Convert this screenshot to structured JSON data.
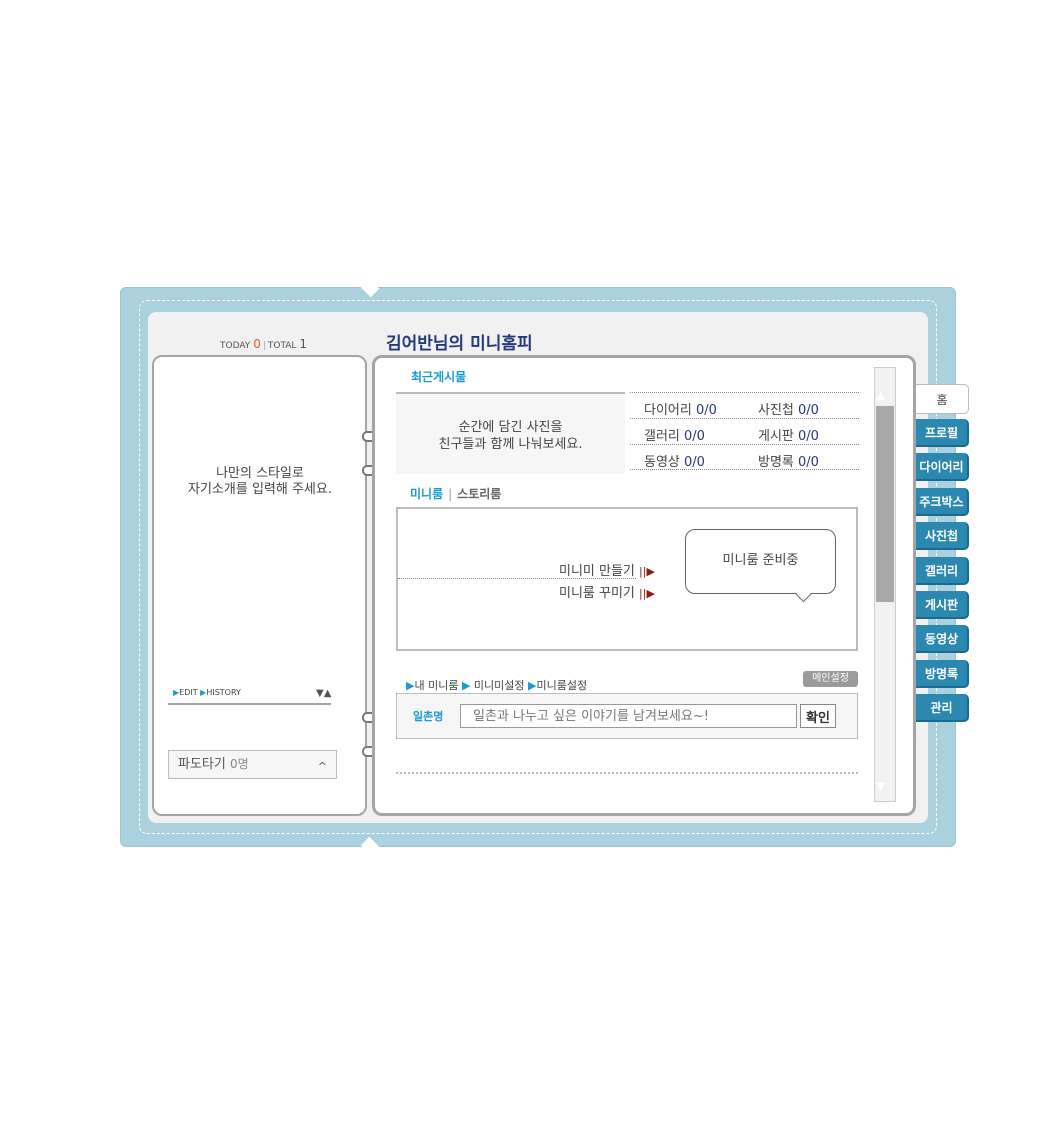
{
  "counter": {
    "today_label": "TODAY",
    "today_value": "0",
    "sep": "|",
    "total_label": "TOTAL",
    "total_value": "1"
  },
  "header": {
    "title": "김어반님의 미니홈피"
  },
  "profile": {
    "intro_line1": "나만의 스타일로",
    "intro_line2": "자기소개를 입력해 주세요.",
    "edit_label": "EDIT",
    "history_label": "HISTORY",
    "sort_arrows": "▼▲"
  },
  "pado": {
    "label": "파도타기",
    "count": "0명",
    "caret": "^"
  },
  "recent": {
    "title": "최근게시물",
    "photo_line1": "순간에 담긴 사진을",
    "photo_line2": "친구들과 함께 나눠보세요.",
    "stats": [
      {
        "name": "다이어리",
        "value": "0/0"
      },
      {
        "name": "사진첩",
        "value": "0/0"
      },
      {
        "name": "갤러리",
        "value": "0/0"
      },
      {
        "name": "게시판",
        "value": "0/0"
      },
      {
        "name": "동영상",
        "value": "0/0"
      },
      {
        "name": "방명록",
        "value": "0/0"
      }
    ]
  },
  "room_tabs": {
    "tab1": "미니룸",
    "separator": "|",
    "tab2": "스토리룸"
  },
  "miniroom": {
    "link1": "미니미 만들기",
    "link2": "미니룸 꾸미기",
    "bubble": "미니룸 준비중",
    "arrow_glyph": "||▶",
    "links": [
      {
        "label": "내 미니룸"
      },
      {
        "label": "미니미설정"
      },
      {
        "label": "미니룸설정"
      }
    ],
    "main_setting": "메인설정"
  },
  "guestbook": {
    "label": "일촌명",
    "placeholder": "일촌과 나누고 싶은 이야기를 남겨보세요~!",
    "confirm": "확인"
  },
  "scroll": {
    "up": "▲",
    "down": "▼"
  },
  "side_tabs": [
    "홈",
    "프로필",
    "다이어리",
    "주크박스",
    "사진첩",
    "갤러리",
    "게시판",
    "동영상",
    "방명록",
    "관리"
  ],
  "colors": {
    "frame": "#acd1de",
    "tab": "#2b88b1",
    "accent": "#1a9bd0",
    "title": "#253a7c",
    "today": "#e45b2d"
  }
}
